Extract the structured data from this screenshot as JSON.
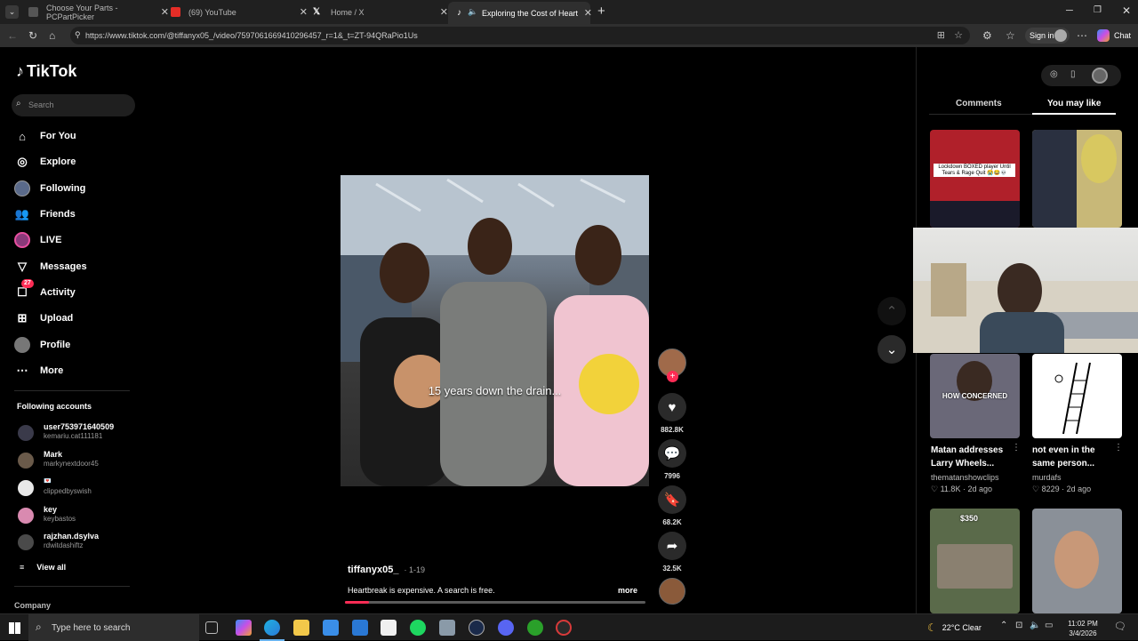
{
  "browser": {
    "tabs": [
      {
        "label": "Choose Your Parts - PCPartPicker"
      },
      {
        "label": "(69) YouTube"
      },
      {
        "label": "Home / X"
      },
      {
        "label": "Exploring the Cost of Heartbr"
      }
    ],
    "url": "https://www.tiktok.com/@tiffanyx05_/video/7597061669410296457_r=1&_t=ZT-94QRaPio1Us",
    "signin_label": "Sign in",
    "chat_label": "Chat"
  },
  "sidebar": {
    "logo": "TikTok",
    "search_placeholder": "Search",
    "nav": [
      {
        "label": "For You",
        "icon": "home-icon"
      },
      {
        "label": "Explore",
        "icon": "compass-icon"
      },
      {
        "label": "Following",
        "icon": "following-avatar"
      },
      {
        "label": "Friends",
        "icon": "friends-icon"
      },
      {
        "label": "LIVE",
        "icon": "live-icon"
      },
      {
        "label": "Messages",
        "icon": "messages-icon"
      },
      {
        "label": "Activity",
        "icon": "activity-icon",
        "badge": "27"
      },
      {
        "label": "Upload",
        "icon": "upload-icon"
      },
      {
        "label": "Profile",
        "icon": "profile-icon"
      },
      {
        "label": "More",
        "icon": "more-icon"
      }
    ],
    "following_title": "Following accounts",
    "accounts": [
      {
        "name": "user753971640509",
        "handle": "kemariu.cat111181"
      },
      {
        "name": "Mark",
        "handle": "markynextdoor45"
      },
      {
        "name": "💌",
        "handle": "clippedbyswish"
      },
      {
        "name": "key",
        "handle": "keybastos"
      },
      {
        "name": "rajzhan.dsylva",
        "handle": "rdwitdashiftz"
      }
    ],
    "view_all": "View all",
    "company": "Company"
  },
  "video": {
    "caption_overlay": "15 years down the drain...",
    "author": "tiffanyx05_",
    "date": "· 1-19",
    "description": "Heartbreak is expensive. A search is free.",
    "more_label": "more",
    "progress": 0.08,
    "likes": "882.8K",
    "comments": "7996",
    "saves": "68.2K",
    "shares": "32.5K"
  },
  "right_panel": {
    "tabs": [
      "Comments",
      "You may like"
    ],
    "active_tab": "You may like",
    "card_top_text": "Lockdown BOXED player Until Tears & Rage Quit 😭😂💀",
    "cards": [
      {
        "overlay": "HOW CONCERNED",
        "title": "Matan addresses Larry Wheels...",
        "author": "thematanshowclips",
        "likes": "11.8K",
        "age": "2d ago"
      },
      {
        "overlay": "",
        "title": "not even in the same person...",
        "author": "murdafs",
        "likes": "8229",
        "age": "2d ago"
      }
    ],
    "price_tag": "$350"
  },
  "taskbar": {
    "search_placeholder": "Type here to search",
    "weather": "22°C  Clear",
    "time": "11:02 PM",
    "date": "3/4/2026"
  },
  "colors": {
    "accent": "#fe2c55",
    "bg": "#000000",
    "tab_bg": "#202020"
  }
}
